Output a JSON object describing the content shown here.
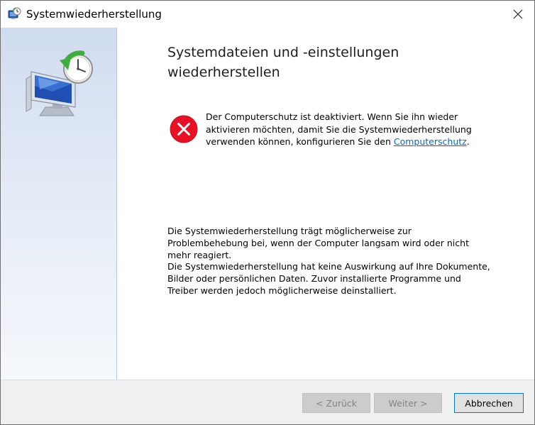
{
  "window": {
    "title": "Systemwiederherstellung"
  },
  "content": {
    "heading_line1": "Systemdateien und -einstellungen",
    "heading_line2": "wiederherstellen",
    "error": {
      "text_before_link": "Der Computerschutz ist deaktiviert. Wenn Sie ihn wieder aktivieren möchten, damit Sie die Systemwiederherstellung verwenden können, konfigurieren Sie den ",
      "link_text": "Computerschutz",
      "text_after_link": "."
    },
    "paragraph1": "Die Systemwiederherstellung trägt möglicherweise zur Problembehebung bei, wenn der Computer langsam wird oder nicht mehr reagiert.",
    "paragraph2": "Die Systemwiederherstellung hat keine Auswirkung auf Ihre Dokumente, Bilder oder persönlichen Daten. Zuvor installierte Programme und Treiber werden jedoch möglicherweise deinstalliert."
  },
  "buttons": {
    "back_label": "< Zurück",
    "next_label": "Weiter >",
    "cancel_label": "Abbrechen"
  },
  "icons": {
    "app": "system-restore-icon",
    "hero": "system-restore-monitor-clock-icon",
    "error": "error-icon",
    "close": "close-icon"
  },
  "colors": {
    "accent": "#0078d7",
    "link": "#0066cc",
    "error_red": "#e81123"
  }
}
